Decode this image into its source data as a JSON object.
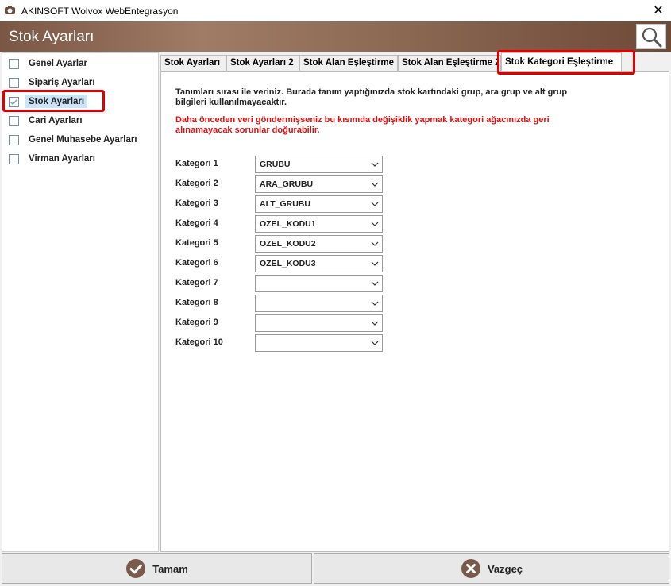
{
  "window": {
    "title": "AKINSOFT Wolvox WebEntegrasyon"
  },
  "header": {
    "title": "Stok Ayarları"
  },
  "sidebar": {
    "items": [
      {
        "label": "Genel Ayarlar",
        "checked": false
      },
      {
        "label": "Sipariş Ayarları",
        "checked": false
      },
      {
        "label": "Stok Ayarları",
        "checked": true
      },
      {
        "label": "Cari Ayarları",
        "checked": false
      },
      {
        "label": "Genel Muhasebe Ayarları",
        "checked": false
      },
      {
        "label": "Virman Ayarları",
        "checked": false
      }
    ]
  },
  "tabs": [
    {
      "label": "Stok Ayarları"
    },
    {
      "label": "Stok Ayarları 2"
    },
    {
      "label": "Stok Alan Eşleştirme"
    },
    {
      "label": "Stok Alan Eşleştirme 2"
    },
    {
      "label": "Stok Kategori Eşleştirme"
    }
  ],
  "panel": {
    "description": "Tanımları sırası ile veriniz. Burada tanım yaptığınızda stok kartındaki grup, ara grup ve alt grup bilgileri kullanılmayacaktır.",
    "warning": "Daha önceden veri göndermişseniz bu kısımda değişiklik yapmak kategori ağacınızda geri alınamayacak sorunlar doğurabilir.",
    "categories": [
      {
        "label": "Kategori 1",
        "value": "GRUBU"
      },
      {
        "label": "Kategori 2",
        "value": "ARA_GRUBU"
      },
      {
        "label": "Kategori 3",
        "value": "ALT_GRUBU"
      },
      {
        "label": "Kategori 4",
        "value": "OZEL_KODU1"
      },
      {
        "label": "Kategori 5",
        "value": "OZEL_KODU2"
      },
      {
        "label": "Kategori 6",
        "value": "OZEL_KODU3"
      },
      {
        "label": "Kategori 7",
        "value": ""
      },
      {
        "label": "Kategori 8",
        "value": ""
      },
      {
        "label": "Kategori 9",
        "value": ""
      },
      {
        "label": "Kategori 10",
        "value": ""
      }
    ]
  },
  "footer": {
    "ok_label": "Tamam",
    "cancel_label": "Vazgeç"
  },
  "colors": {
    "header_brown": "#8a6852",
    "highlight_red": "#e00000",
    "warning_red": "#e01010"
  }
}
